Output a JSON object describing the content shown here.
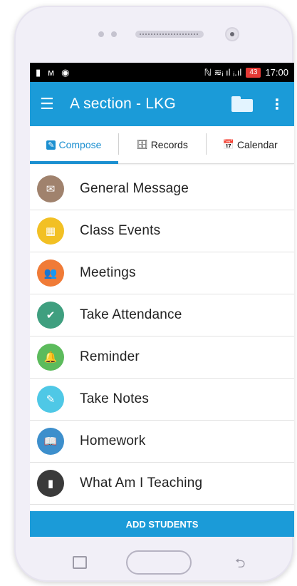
{
  "status": {
    "icons": [
      "battery-alert-icon",
      "m-icon",
      "app-icon"
    ],
    "right_signal": "ℕ  ≋ᵢ ıl ᵢ.ıl",
    "battery": "43",
    "time": "17:00"
  },
  "appbar": {
    "title": "A section  -  LKG"
  },
  "tabs": [
    {
      "label": "Compose",
      "icon": "compose-icon"
    },
    {
      "label": "Records",
      "icon": "database-icon"
    },
    {
      "label": "Calendar",
      "icon": "calendar-icon"
    }
  ],
  "items": [
    {
      "label": "General Message",
      "icon": "envelope-icon",
      "color": "#a0826d"
    },
    {
      "label": "Class Events",
      "icon": "calendar-icon",
      "color": "#f2c024"
    },
    {
      "label": "Meetings",
      "icon": "people-icon",
      "color": "#f07b37"
    },
    {
      "label": "Take Attendance",
      "icon": "check-icon",
      "color": "#3f9f7f"
    },
    {
      "label": "Reminder",
      "icon": "bell-icon",
      "color": "#5cbb5c"
    },
    {
      "label": "Take Notes",
      "icon": "edit-icon",
      "color": "#4fc8e6"
    },
    {
      "label": "Homework",
      "icon": "book-icon",
      "color": "#3d8fcc"
    },
    {
      "label": "What Am I Teaching",
      "icon": "bookmark-icon",
      "color": "#3a3a3a"
    }
  ],
  "footer": {
    "add_students_label": "ADD STUDENTS"
  },
  "colors": {
    "primary": "#1b9bd8",
    "active_tab": "#1b8fd0"
  }
}
